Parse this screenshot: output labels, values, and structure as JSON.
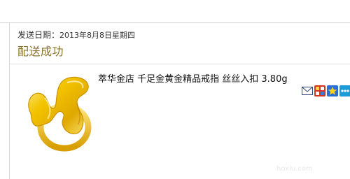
{
  "order": {
    "date_label": "发送日期：",
    "date_value": "2013年8月8日星期四",
    "status": "配送成功"
  },
  "product": {
    "title": "萃华金店 千足金黄金精品戒指 丝丝入扣 3.80g",
    "image_icon": "gold-ring-image",
    "actions": [
      {
        "icon": "mail-icon"
      },
      {
        "icon": "share-icon"
      },
      {
        "icon": "star-icon"
      },
      {
        "icon": "more-icon"
      }
    ]
  },
  "watermark": "hoxiu.com",
  "colors": {
    "status": "#8c7530",
    "gold": "#f2c200",
    "rule": "#d9d9d9"
  }
}
